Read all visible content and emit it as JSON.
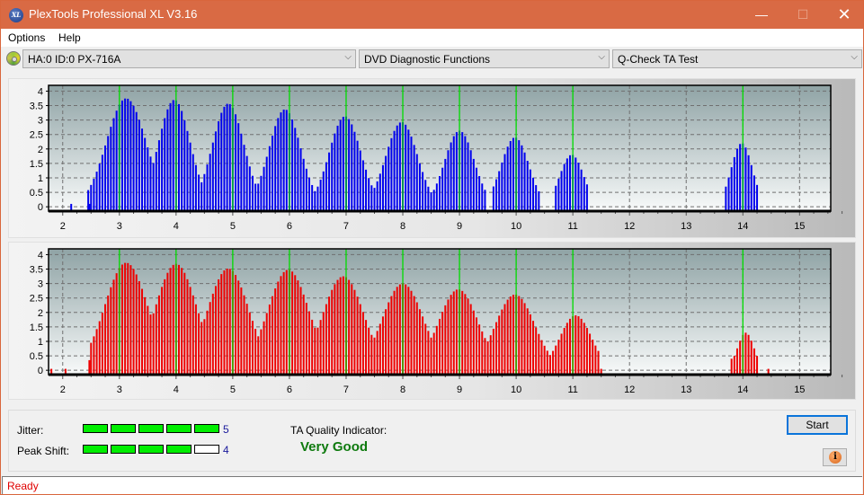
{
  "window": {
    "title": "PlexTools Professional XL V3.16",
    "app_icon_text": "XL",
    "controls": {
      "minimize": "—",
      "maximize": "☐",
      "close": "✕"
    }
  },
  "menu": {
    "items": [
      {
        "label": "Options"
      },
      {
        "label": "Help"
      }
    ]
  },
  "toolbar": {
    "drive_select": {
      "value": "HA:0 ID:0  PX-716A"
    },
    "function_select": {
      "value": "DVD Diagnostic Functions"
    },
    "test_select": {
      "value": "Q-Check TA Test"
    },
    "arrow": "⌵"
  },
  "colors": {
    "top_bars": "#0000ee",
    "bottom_bars": "#ee0000",
    "marker_lines": "#00dd00",
    "quality_text": "#0e7a0e",
    "status_text": "#e00000",
    "titlebar": "#d96a44"
  },
  "chart_data": [
    {
      "type": "bar",
      "name": "top-chart",
      "title": "",
      "xlabel": "",
      "ylabel": "",
      "xlim": [
        1.75,
        15.55
      ],
      "ylim": [
        -0.15,
        4.2
      ],
      "x_ticks": [
        2,
        3,
        4,
        5,
        6,
        7,
        8,
        9,
        10,
        11,
        12,
        13,
        14,
        15
      ],
      "y_ticks": [
        "0",
        "0.5",
        "1",
        "1.5",
        "2",
        "2.5",
        "3",
        "3.5",
        "4"
      ],
      "y_tick_values": [
        0,
        0.5,
        1,
        1.5,
        2,
        2.5,
        3,
        3.5,
        4
      ],
      "grid": true,
      "marker_lines": [
        3,
        4,
        5,
        6,
        7,
        8,
        9,
        10,
        11,
        14
      ],
      "bar_step": 0.05,
      "peaks": [
        {
          "center": 3.12,
          "height": 3.75,
          "half_width": 0.6
        },
        {
          "center": 3.97,
          "height": 3.7,
          "half_width": 0.48
        },
        {
          "center": 4.92,
          "height": 3.57,
          "half_width": 0.48
        },
        {
          "center": 5.92,
          "height": 3.37,
          "half_width": 0.48
        },
        {
          "center": 6.98,
          "height": 3.13,
          "half_width": 0.48
        },
        {
          "center": 7.98,
          "height": 2.93,
          "half_width": 0.48
        },
        {
          "center": 9.0,
          "height": 2.63,
          "half_width": 0.45
        },
        {
          "center": 9.98,
          "height": 2.4,
          "half_width": 0.42
        },
        {
          "center": 10.98,
          "height": 1.8,
          "half_width": 0.36
        },
        {
          "center": 13.98,
          "height": 2.2,
          "half_width": 0.32
        }
      ],
      "ranges": [
        [
          2.45,
          4.4
        ],
        [
          4.45,
          5.45
        ],
        [
          5.45,
          6.45
        ],
        [
          6.5,
          7.45
        ],
        [
          7.45,
          8.45
        ],
        [
          8.45,
          9.45
        ],
        [
          9.6,
          10.4
        ],
        [
          10.7,
          11.28
        ],
        [
          13.68,
          14.28
        ]
      ],
      "isolated_bars": [
        {
          "x": 2.15,
          "y": 0.1
        },
        {
          "x": 2.47,
          "y": 0.1
        }
      ]
    },
    {
      "type": "bar",
      "name": "bottom-chart",
      "title": "",
      "xlabel": "",
      "ylabel": "",
      "xlim": [
        1.75,
        15.55
      ],
      "ylim": [
        -0.15,
        4.2
      ],
      "x_ticks": [
        2,
        3,
        4,
        5,
        6,
        7,
        8,
        9,
        10,
        11,
        12,
        13,
        14,
        15
      ],
      "y_ticks": [
        "0",
        "0.5",
        "1",
        "1.5",
        "2",
        "2.5",
        "3",
        "3.5",
        "4"
      ],
      "y_tick_values": [
        0,
        0.5,
        1,
        1.5,
        2,
        2.5,
        3,
        3.5,
        4
      ],
      "grid": true,
      "marker_lines": [
        3,
        4,
        5,
        6,
        7,
        8,
        9,
        10,
        11,
        14
      ],
      "bar_step": 0.05,
      "peaks": [
        {
          "center": 3.12,
          "height": 3.72,
          "half_width": 0.65
        },
        {
          "center": 4.0,
          "height": 3.68,
          "half_width": 0.62
        },
        {
          "center": 4.92,
          "height": 3.52,
          "half_width": 0.62
        },
        {
          "center": 5.98,
          "height": 3.48,
          "half_width": 0.62
        },
        {
          "center": 6.95,
          "height": 3.25,
          "half_width": 0.62
        },
        {
          "center": 8.0,
          "height": 3.0,
          "half_width": 0.62
        },
        {
          "center": 8.98,
          "height": 2.8,
          "half_width": 0.6
        },
        {
          "center": 9.98,
          "height": 2.62,
          "half_width": 0.6
        },
        {
          "center": 11.05,
          "height": 1.9,
          "half_width": 0.48
        },
        {
          "center": 14.05,
          "height": 1.3,
          "half_width": 0.25
        }
      ],
      "ranges": [
        [
          2.5,
          11.45
        ],
        [
          13.85,
          14.25
        ]
      ],
      "isolated_bars": [
        {
          "x": 1.8,
          "y": 0.05
        },
        {
          "x": 2.05,
          "y": 0.05
        },
        {
          "x": 2.47,
          "y": 0.35
        },
        {
          "x": 11.45,
          "y": 0.05
        },
        {
          "x": 11.5,
          "y": 0.05
        },
        {
          "x": 13.8,
          "y": 0.4
        },
        {
          "x": 14.25,
          "y": 0.05
        },
        {
          "x": 14.45,
          "y": 0.05
        }
      ]
    }
  ],
  "results": {
    "jitter": {
      "label": "Jitter:",
      "value": "5",
      "level": 5,
      "max": 5
    },
    "peak_shift": {
      "label": "Peak Shift:",
      "value": "4",
      "level": 4,
      "max": 5
    },
    "ta_quality_label": "TA Quality Indicator:",
    "ta_quality_value": "Very Good"
  },
  "buttons": {
    "start": "Start",
    "info": "i"
  },
  "status": {
    "text": "Ready"
  }
}
